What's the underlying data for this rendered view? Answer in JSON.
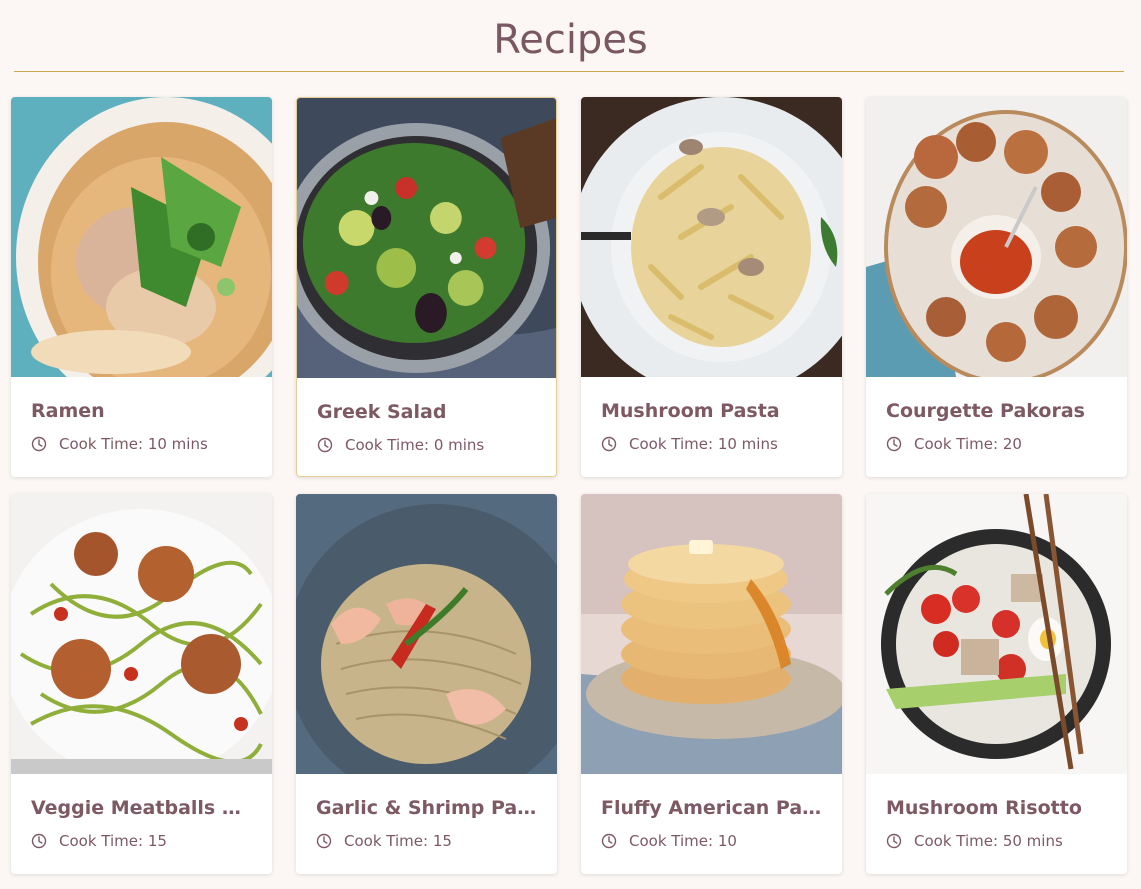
{
  "page": {
    "title": "Recipes"
  },
  "theme": {
    "background": "#fcf7f4",
    "accent_rule": "#c9a757",
    "text": "#7d5963"
  },
  "recipes": [
    {
      "name": "Ramen",
      "meta_label": "Cook Time:",
      "cook_time": "10 mins",
      "image": "ramen-image"
    },
    {
      "name": "Greek Salad",
      "meta_label": "Cook Time:",
      "cook_time": "0 mins",
      "image": "greek-salad-image"
    },
    {
      "name": "Mushroom Pasta",
      "meta_label": "Cook Time:",
      "cook_time": "10 mins",
      "image": "mushroom-pasta-image"
    },
    {
      "name": "Courgette Pakoras",
      "meta_label": "Cook Time:",
      "cook_time": "20",
      "image": "courgette-pakoras-image"
    },
    {
      "name": "Veggie Meatballs wi...",
      "meta_label": "Cook Time:",
      "cook_time": "15",
      "image": "veggie-meatballs-image"
    },
    {
      "name": "Garlic & Shrimp Pasta",
      "meta_label": "Cook Time:",
      "cook_time": "15",
      "image": "garlic-shrimp-pasta-image"
    },
    {
      "name": "Fluffy American Pan...",
      "meta_label": "Cook Time:",
      "cook_time": "10",
      "image": "pancakes-image"
    },
    {
      "name": "Mushroom Risotto",
      "meta_label": "Cook Time:",
      "cook_time": "50 mins",
      "image": "mushroom-risotto-image"
    }
  ]
}
